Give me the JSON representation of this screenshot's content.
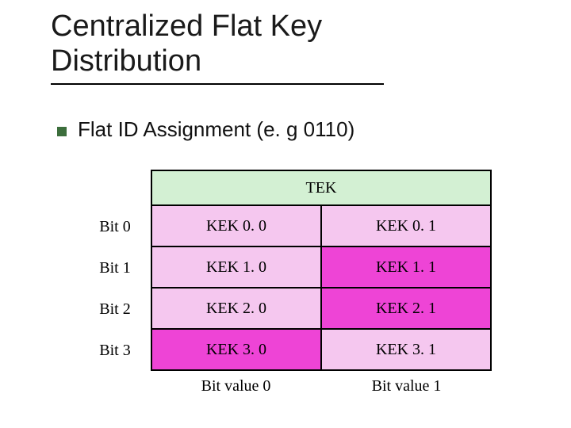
{
  "title": {
    "line1": "Centralized Flat Key",
    "line2": "Distribution"
  },
  "subtitle": "Flat ID Assignment (e. g 0110)",
  "table": {
    "header": "TEK",
    "rows": [
      {
        "label": "Bit 0",
        "c0": "KEK 0. 0",
        "c1": "KEK 0. 1",
        "bg0": "#f5c7ef",
        "bg1": "#f5c7ef"
      },
      {
        "label": "Bit 1",
        "c0": "KEK 1. 0",
        "c1": "KEK 1. 1",
        "bg0": "#f5c7ef",
        "bg1": "#ee44d6"
      },
      {
        "label": "Bit 2",
        "c0": "KEK 2. 0",
        "c1": "KEK 2. 1",
        "bg0": "#f5c7ef",
        "bg1": "#ee44d6"
      },
      {
        "label": "Bit 3",
        "c0": "KEK 3. 0",
        "c1": "KEK 3. 1",
        "bg0": "#ee44d6",
        "bg1": "#f5c7ef"
      }
    ],
    "footer": {
      "c0": "Bit value 0",
      "c1": "Bit value 1"
    }
  },
  "colors": {
    "tek_bg": "#d3f0d3"
  }
}
